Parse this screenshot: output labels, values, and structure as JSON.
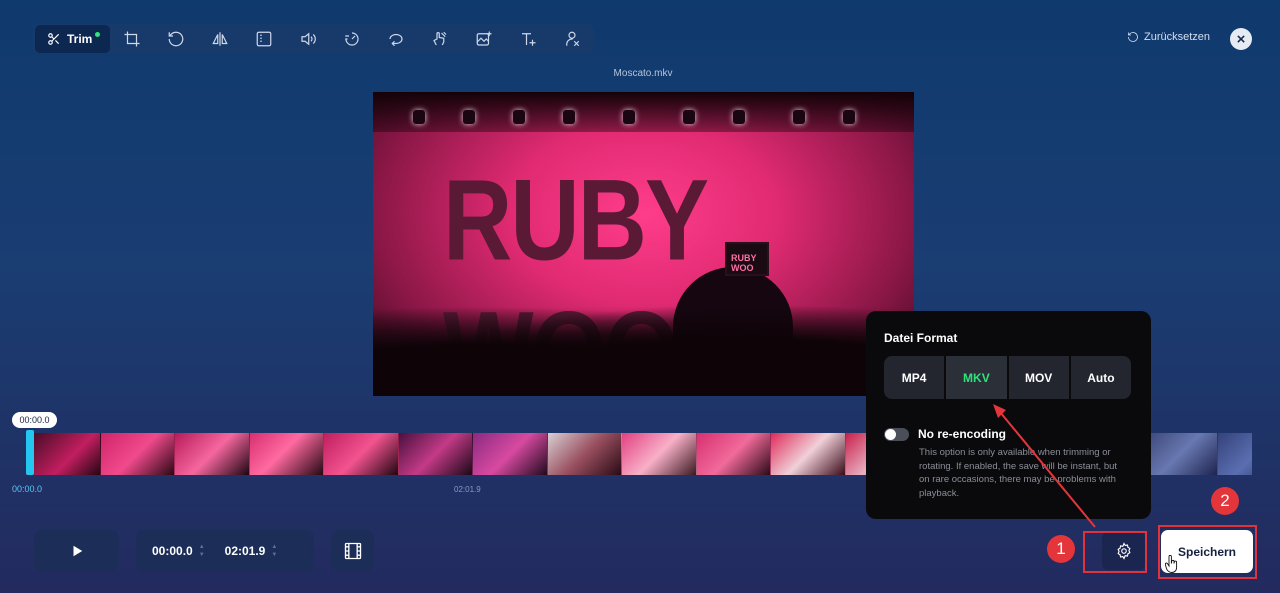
{
  "toolbar": {
    "trim_label": "Trim",
    "tools": [
      "crop-icon",
      "rotate-icon",
      "flip-icon",
      "border-icon",
      "volume-icon",
      "speed-icon",
      "loop-icon",
      "stabilize-icon",
      "add-image-icon",
      "add-text-icon",
      "remove-object-icon"
    ]
  },
  "header": {
    "reset_label": "Zurücksetzen",
    "filename": "Moscato.mkv"
  },
  "video": {
    "band_text": "RUBY WOO",
    "phone_text": "RUBY WOO"
  },
  "timeline": {
    "bubble_time": "00:00.0",
    "start_label": "00:00.0",
    "end_label": "02:01.9"
  },
  "controls": {
    "start_time": "00:00.0",
    "end_time": "02:01.9"
  },
  "popup": {
    "title": "Datei Format",
    "formats": [
      "MP4",
      "MKV",
      "MOV",
      "Auto"
    ],
    "selected_format": "MKV",
    "toggle_label": "No re-encoding",
    "toggle_on": false,
    "note": "This option is only available when trimming or rotating. If enabled, the save will be instant, but on rare occasions, there may be problems with playback."
  },
  "save_label": "Speichern",
  "annotations": {
    "badge1": "1",
    "badge2": "2"
  },
  "colors": {
    "accent_green": "#2ee37c",
    "annotation_red": "#e4353a",
    "handle_blue": "#24c7f0"
  }
}
